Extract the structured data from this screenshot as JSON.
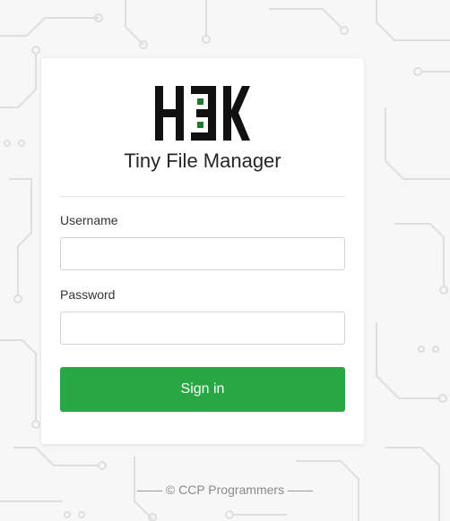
{
  "logo": {
    "text": "H3K",
    "colors": {
      "letters": "#111111",
      "accent": "#1f7a2e"
    }
  },
  "app": {
    "title": "Tiny File Manager"
  },
  "form": {
    "username_label": "Username",
    "username_value": "",
    "password_label": "Password",
    "password_value": "",
    "signin_label": "Sign in"
  },
  "footer": {
    "text": "© CCP Programmers"
  },
  "colors": {
    "button": "#28a745",
    "background": "#f7f7f7",
    "pattern": "#dcdcdc"
  }
}
